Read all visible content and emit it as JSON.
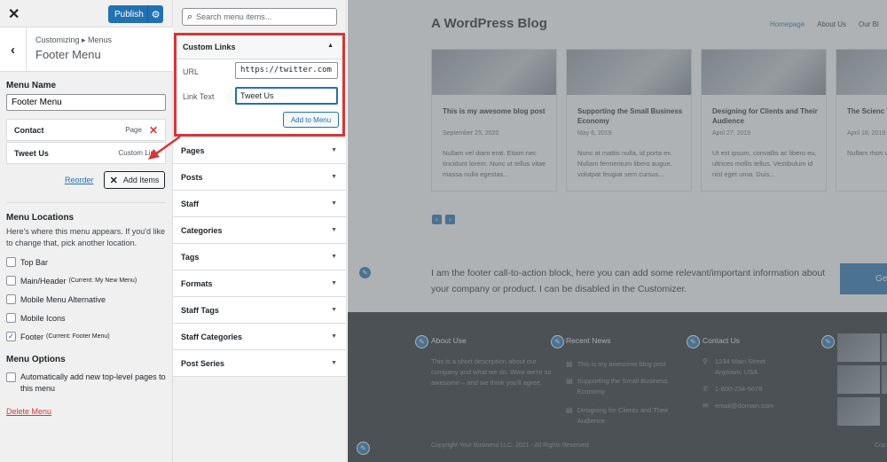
{
  "customizer": {
    "close_icon": "close-icon",
    "publish_label": "Publish",
    "breadcrumb": "Customizing ▸ Menus",
    "section_title": "Footer Menu",
    "menu_name_label": "Menu Name",
    "menu_name_value": "Footer Menu",
    "menu_items": [
      {
        "title": "Contact",
        "type": "Page"
      },
      {
        "title": "Tweet Us",
        "type": "Custom Link"
      }
    ],
    "reorder_label": "Reorder",
    "add_items_label": "Add Items",
    "locations_heading": "Menu Locations",
    "locations_desc": "Here's where this menu appears. If you'd like to change that, pick another location.",
    "locations": [
      {
        "label": "Top Bar",
        "note": "",
        "checked": false
      },
      {
        "label": "Main/Header",
        "note": "(Current: My New Menu)",
        "checked": false
      },
      {
        "label": "Mobile Menu Alternative",
        "note": "",
        "checked": false
      },
      {
        "label": "Mobile Icons",
        "note": "",
        "checked": false
      },
      {
        "label": "Footer",
        "note": "(Current: Footer Menu)",
        "checked": true
      }
    ],
    "options_heading": "Menu Options",
    "auto_add_label": "Automatically add new top-level pages to this menu",
    "delete_label": "Delete Menu"
  },
  "available": {
    "search_placeholder": "Search menu items...",
    "custom_links": {
      "title": "Custom Links",
      "url_label": "URL",
      "url_value": "https://twitter.com",
      "text_label": "Link Text",
      "text_value": "Tweet Us",
      "add_button": "Add to Menu"
    },
    "sections": [
      "Pages",
      "Posts",
      "Staff",
      "Categories",
      "Tags",
      "Formats",
      "Staff Tags",
      "Staff Categories",
      "Post Series"
    ]
  },
  "preview": {
    "site_title": "A WordPress Blog",
    "nav": [
      "Homepage",
      "About Us",
      "Our Bl"
    ],
    "posts": [
      {
        "title": "This is my awesome blog post",
        "date": "September 25, 2020",
        "excerpt": "Nullam vel diam erat. Etiam nec tincidunt lorem. Nunc ut tellus vitae massa nulla egestas..."
      },
      {
        "title": "Supporting the Small Business Economy",
        "date": "May 6, 2019",
        "excerpt": "Nunc at mattis nulla, id porta ex. Nullam fermentum libero augue, volutpat feugiat sem cursus..."
      },
      {
        "title": "Designing for Clients and Their Audience",
        "date": "April 27, 2019",
        "excerpt": "Ut est ipsum, convallis ac libero eu, ultrices mollis tellus. Vestibulum id nisl eget urna. Duis..."
      },
      {
        "title": "The Scienc Work (Vide",
        "date": "April 18, 2019",
        "excerpt": "Nullam rhon vestibulum dolor libero"
      }
    ],
    "cta_text": "I am the footer call-to-action block, here you can add some relevant/important information about your company or product. I can be disabled in the Customizer.",
    "cta_button": "Ge",
    "footer": {
      "about_title": "About Use",
      "about_text": "This is a short description about our company and what we do. Wow we're so awesome – and we think you'll agree.",
      "news_title": "Recent News",
      "news": [
        "This is my awesome blog post",
        "Supporting the Small Business Economy",
        "Designing for Clients and Their Audience"
      ],
      "contact_title": "Contact Us",
      "address1": "1234 Main Street",
      "address2": "Anytown, USA",
      "phone": "1-800-234-5678",
      "email": "email@domain.com",
      "copyright": "Copyright Your Business LLC. 2021 - All Rights Reserved",
      "copyright_right": "Cop"
    }
  },
  "colors": {
    "accent": "#2271b1",
    "highlight": "#d63638",
    "footer_bg": "#23282d"
  }
}
